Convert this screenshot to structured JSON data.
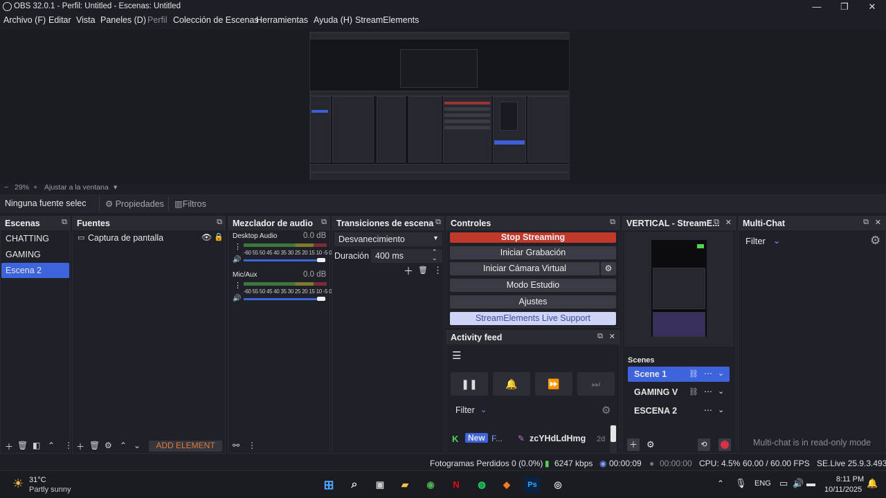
{
  "window": {
    "title": "OBS 32.0.1 - Perfil: Untitled - Escenas: Untitled",
    "minimize": "—",
    "maximize": "❐",
    "close": "✕"
  },
  "menu": [
    "Archivo (F)",
    "Editar",
    "Vista",
    "Paneles (D)",
    "Perfil",
    "Colección de Escenas",
    "Herramientas",
    "Ayuda (H)",
    "StreamElements"
  ],
  "zoom": {
    "minus": "−",
    "level": "29%",
    "plus": "+",
    "fit": "Ajustar a la ventana",
    "arrow": "▾"
  },
  "context": {
    "no_source": "Ninguna fuente selec",
    "properties": "Propiedades",
    "filters": "Filtros"
  },
  "scenes": {
    "title": "Escenas",
    "items": [
      "CHATTING",
      "GAMING",
      "Escena 2"
    ],
    "selected": 2
  },
  "sources": {
    "title": "Fuentes",
    "items": [
      {
        "name": "Captura de pantalla"
      }
    ],
    "add_element": "ADD ELEMENT"
  },
  "mixer": {
    "title": "Mezclador de audio",
    "channels": [
      {
        "name": "Desktop Audio",
        "db": "0.0 dB"
      },
      {
        "name": "Mic/Aux",
        "db": "0.0 dB"
      }
    ],
    "ticks": "-60 55 50 45 40 35 30 25 20 15 10 -5  0"
  },
  "transitions": {
    "title": "Transiciones de escena",
    "selected": "Desvanecimiento",
    "duration_label": "Duración",
    "duration_value": "400 ms"
  },
  "controls": {
    "title": "Controles",
    "stop_streaming": "Stop Streaming",
    "start_recording": "Iniciar Grabación",
    "virtual_camera": "Iniciar Cámara Virtual",
    "studio_mode": "Modo Estudio",
    "settings": "Ajustes",
    "support": "StreamElements Live Support"
  },
  "activity": {
    "title": "Activity feed",
    "filter": "Filter",
    "entry": {
      "badge": "New",
      "tag": "F...",
      "user": "zcYHdLdHmg",
      "age": "2d"
    }
  },
  "vertical": {
    "title": "VERTICAL - StreamE...",
    "scenes_label": "Scenes",
    "scenes": [
      "Scene 1",
      "GAMING V",
      "ESCENA 2"
    ],
    "selected": 0
  },
  "multichat": {
    "title": "Multi-Chat",
    "filter": "Filter",
    "readonly": "Multi-chat is in read-only mode"
  },
  "status": {
    "dropped": "Fotogramas Perdidos 0 (0.0%)",
    "bitrate": "6247 kbps",
    "stream_time": "00:00:09",
    "rec_time": "00:00:00",
    "cpu": "CPU: 4.5%",
    "fps": "60.00 / 60.00 FPS",
    "version": "SE.Live 25.9.3.493"
  },
  "taskbar": {
    "weather_temp": "31°C",
    "weather_desc": "Partly sunny",
    "lang": "ENG",
    "time": "8:11 PM",
    "date": "10/11/2025"
  },
  "colors": {
    "accent": "#3d63dd",
    "stop": "#c0392b",
    "bg": "#1e1f26"
  }
}
